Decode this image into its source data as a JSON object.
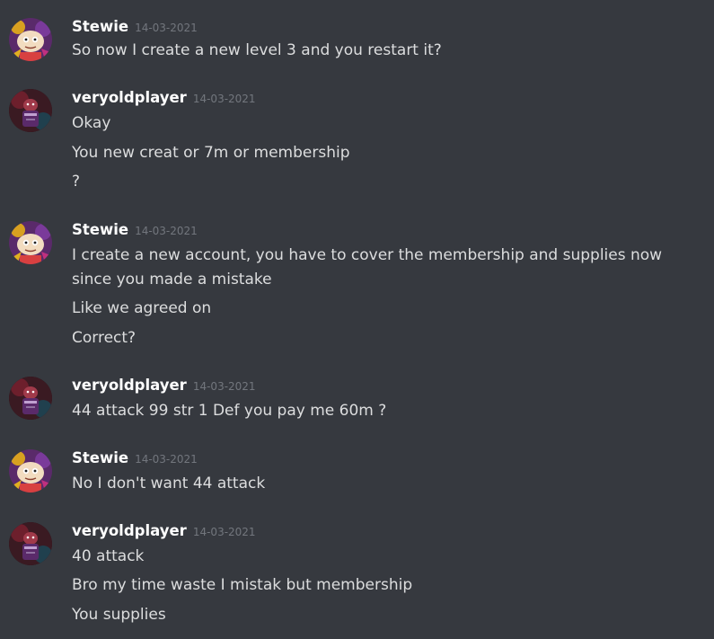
{
  "messages": [
    {
      "username": "Stewie",
      "timestamp": "14-03-2021",
      "avatar": "stewie-avatar",
      "lines": [
        "So now I create a new level 3 and you restart it?"
      ]
    },
    {
      "username": "veryoldplayer",
      "timestamp": "14-03-2021",
      "avatar": "veryoldplayer-avatar",
      "lines": [
        "Okay",
        "You new creat or 7m or membership",
        "?"
      ]
    },
    {
      "username": "Stewie",
      "timestamp": "14-03-2021",
      "avatar": "stewie-avatar",
      "lines": [
        "I create a new account, you have to cover the membership and supplies now",
        "since you made a mistake",
        "Like we agreed on",
        "Correct?"
      ]
    },
    {
      "username": "veryoldplayer",
      "timestamp": "14-03-2021",
      "avatar": "veryoldplayer-avatar",
      "lines": [
        "44 attack 99 str 1 Def you pay me 60m ?"
      ]
    },
    {
      "username": "Stewie",
      "timestamp": "14-03-2021",
      "avatar": "stewie-avatar",
      "lines": [
        "No I don't want 44 attack"
      ]
    },
    {
      "username": "veryoldplayer",
      "timestamp": "14-03-2021",
      "avatar": "veryoldplayer-avatar",
      "lines": [
        "40 attack",
        "Bro my time waste I mistak but membership",
        "You supplies"
      ]
    }
  ],
  "colors": {
    "background": "#36393f",
    "username": "#ffffff",
    "timestamp": "#72767d",
    "text": "#dcddde"
  }
}
